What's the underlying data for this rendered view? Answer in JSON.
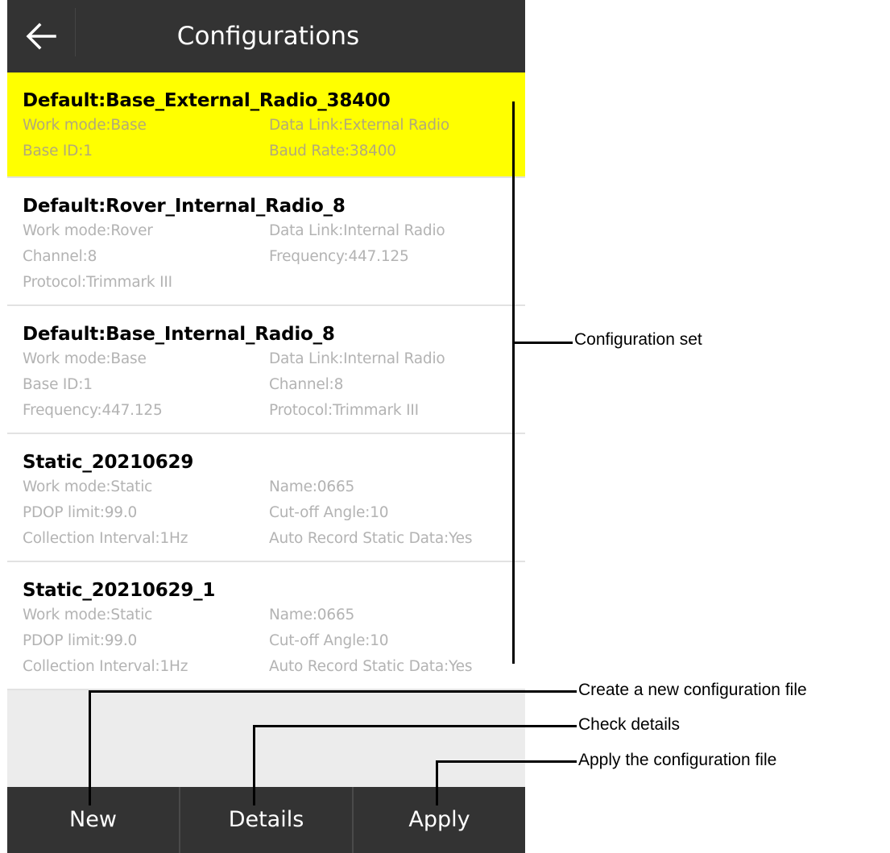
{
  "header": {
    "title": "Configurations",
    "back_icon": "arrow-left-icon"
  },
  "configurations": [
    {
      "name": "Default:Base_External_Radio_38400",
      "selected": true,
      "fields": [
        [
          "Work mode:Base",
          "Data Link:External Radio"
        ],
        [
          "Base ID:1",
          "Baud Rate:38400"
        ]
      ]
    },
    {
      "name": "Default:Rover_Internal_Radio_8",
      "selected": false,
      "fields": [
        [
          "Work mode:Rover",
          "Data Link:Internal Radio"
        ],
        [
          "Channel:8",
          "Frequency:447.125"
        ],
        [
          "Protocol:Trimmark III",
          ""
        ]
      ]
    },
    {
      "name": "Default:Base_Internal_Radio_8",
      "selected": false,
      "fields": [
        [
          "Work mode:Base",
          "Data Link:Internal Radio"
        ],
        [
          "Base ID:1",
          "Channel:8"
        ],
        [
          "Frequency:447.125",
          "Protocol:Trimmark III"
        ]
      ]
    },
    {
      "name": "Static_20210629",
      "selected": false,
      "fields": [
        [
          "Work mode:Static",
          "Name:0665"
        ],
        [
          "PDOP limit:99.0",
          "Cut-off Angle:10"
        ],
        [
          "Collection Interval:1Hz",
          "Auto Record Static Data:Yes"
        ]
      ]
    },
    {
      "name": "Static_20210629_1",
      "selected": false,
      "fields": [
        [
          "Work mode:Static",
          "Name:0665"
        ],
        [
          "PDOP limit:99.0",
          "Cut-off Angle:10"
        ],
        [
          "Collection Interval:1Hz",
          "Auto Record Static Data:Yes"
        ]
      ]
    }
  ],
  "bottom_bar": {
    "new_label": "New",
    "details_label": "Details",
    "apply_label": "Apply"
  },
  "annotations": {
    "configuration_set": "Configuration set",
    "new": "Create a new configuration file",
    "details": "Check details",
    "apply": "Apply the configuration file"
  },
  "colors": {
    "bar": "#333333",
    "selected": "#ffff00",
    "list_bg": "#ececec",
    "field_text": "#b3b3b3"
  }
}
